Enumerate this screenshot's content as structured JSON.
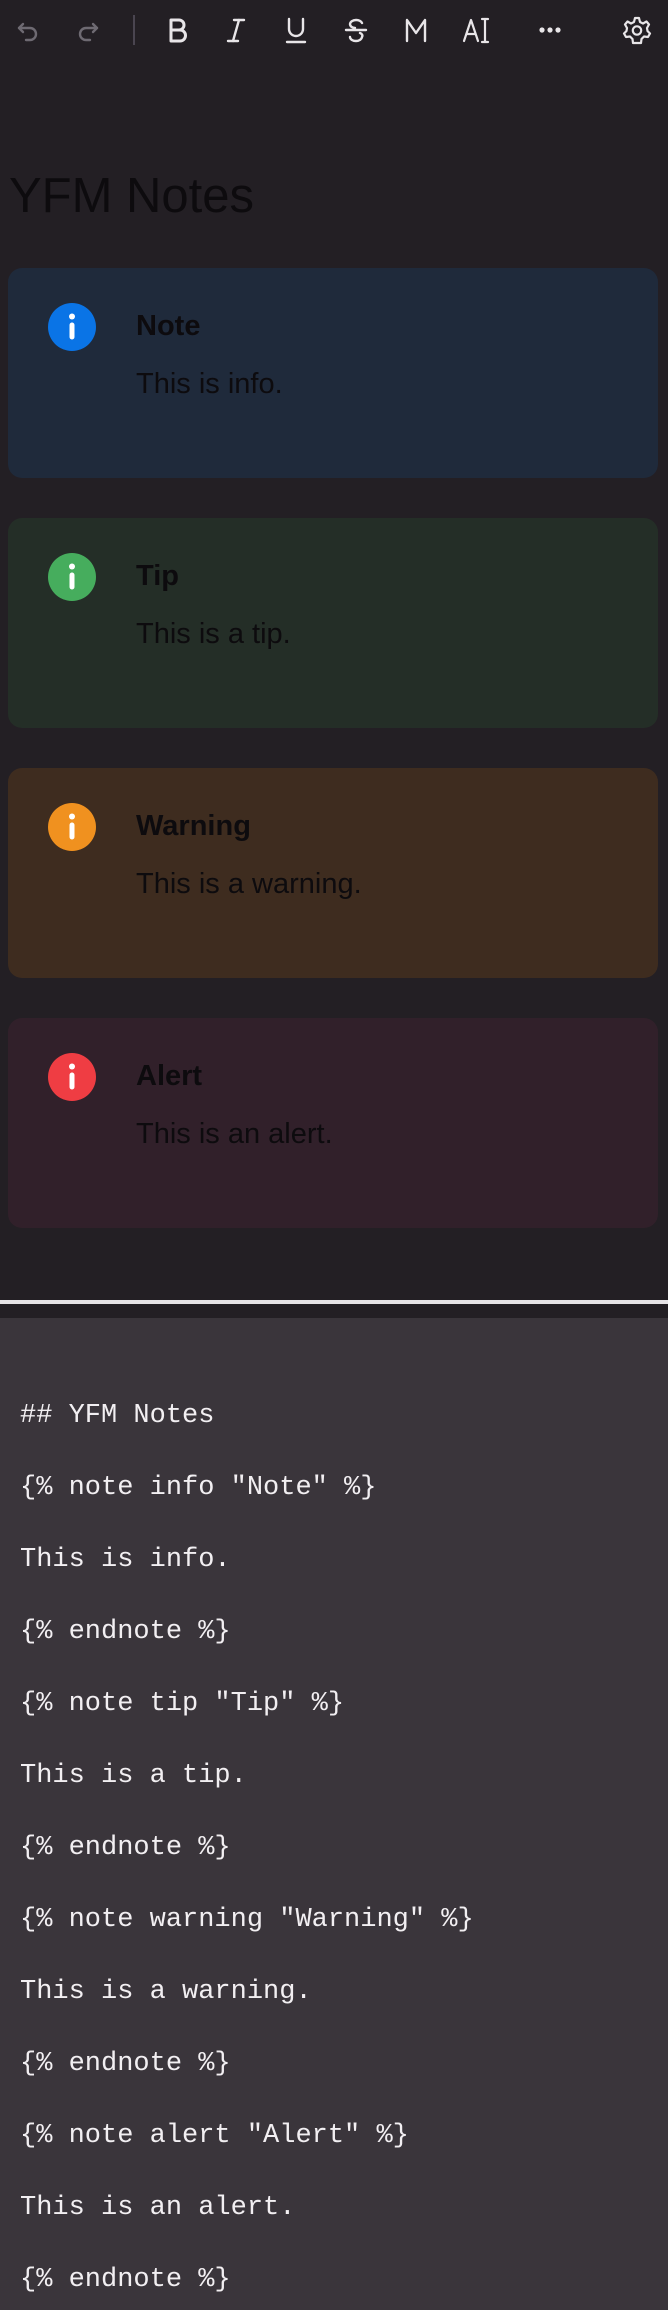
{
  "toolbar": {
    "buttons": [
      {
        "name": "undo-button",
        "icon": "undo-icon"
      },
      {
        "name": "redo-button",
        "icon": "redo-icon"
      },
      {
        "name": "bold-button",
        "icon": "bold-icon"
      },
      {
        "name": "italic-button",
        "icon": "italic-icon"
      },
      {
        "name": "underline-button",
        "icon": "underline-icon"
      },
      {
        "name": "strikethrough-button",
        "icon": "strikethrough-icon"
      },
      {
        "name": "mono-button",
        "icon": "mono-m-icon"
      },
      {
        "name": "text-format-button",
        "icon": "text-cursor-icon"
      },
      {
        "name": "more-button",
        "icon": "more-dots-icon"
      },
      {
        "name": "settings-button",
        "icon": "gear-icon"
      }
    ]
  },
  "preview": {
    "title": "YFM Notes",
    "notes": [
      {
        "kind": "info",
        "title": "Note",
        "body": "This is info.",
        "bg": "#1f2a3b",
        "icon_color": "#0a74e6"
      },
      {
        "kind": "tip",
        "title": "Tip",
        "body": "This is a tip.",
        "bg": "#242e27",
        "icon_color": "#46ad5d"
      },
      {
        "kind": "warning",
        "title": "Warning",
        "body": "This is a warning.",
        "bg": "#3e2c1f",
        "icon_color": "#f0911f"
      },
      {
        "kind": "alert",
        "title": "Alert",
        "body": "This is an alert.",
        "bg": "#31202a",
        "icon_color": "#ef3d43"
      }
    ]
  },
  "source": {
    "lines": [
      "## YFM Notes",
      "{% note info \"Note\" %}",
      "This is info.",
      "{% endnote %}",
      "{% note tip \"Tip\" %}",
      "This is a tip.",
      "{% endnote %}",
      "{% note warning \"Warning\" %}",
      "This is a warning.",
      "{% endnote %}",
      "{% note alert \"Alert\" %}",
      "This is an alert.",
      "{% endnote %}"
    ]
  },
  "colors": {
    "background": "#231f24",
    "source_bg": "#3a353b",
    "toolbar_icon": "#e8e5e8",
    "toolbar_icon_disabled": "#6e6a72"
  }
}
